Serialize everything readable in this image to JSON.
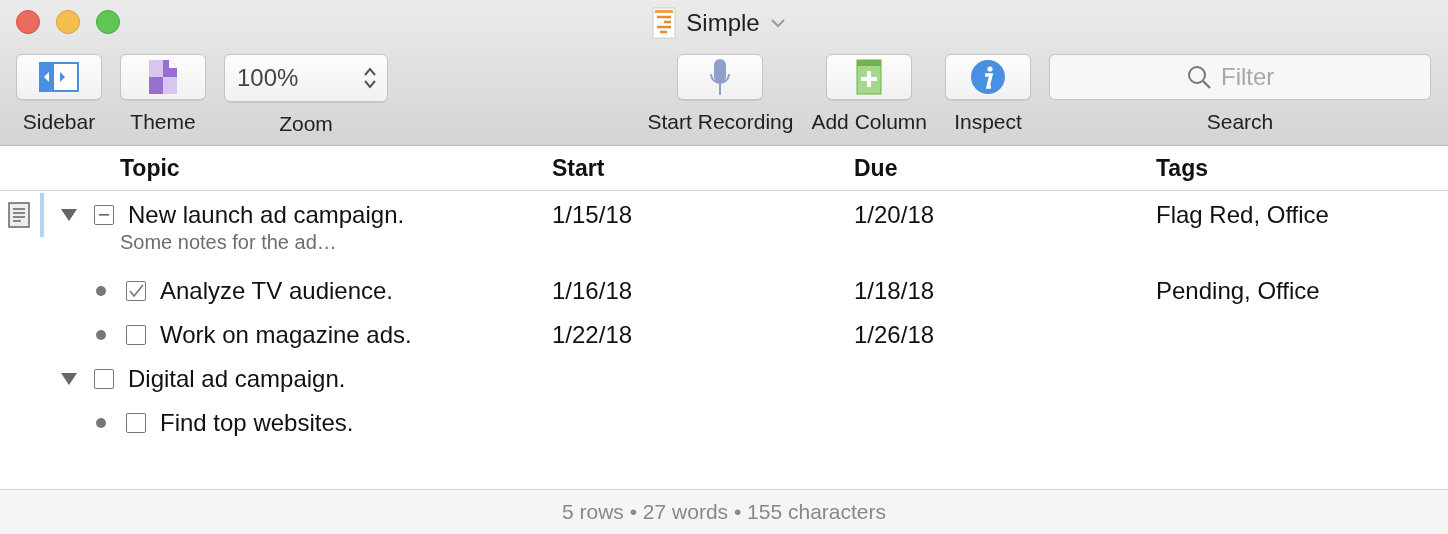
{
  "window": {
    "title": "Simple"
  },
  "toolbar": {
    "left": [
      {
        "kind": "button",
        "label": "Sidebar"
      },
      {
        "kind": "button",
        "label": "Theme"
      },
      {
        "kind": "stepper",
        "label": "Zoom",
        "value": "100%"
      }
    ],
    "right": [
      {
        "kind": "button",
        "label": "Start Recording"
      },
      {
        "kind": "button",
        "label": "Add Column"
      },
      {
        "kind": "button",
        "label": "Inspect"
      },
      {
        "kind": "search",
        "label": "Search",
        "placeholder": "Filter"
      }
    ]
  },
  "table": {
    "columns": [
      "Topic",
      "Start",
      "Due",
      "Tags"
    ],
    "rows": [
      {
        "topic": "New launch ad campaign.",
        "note": "Some notes for the ad…",
        "has_note": true,
        "selected": true,
        "expanded": true,
        "checked": false,
        "mixed": true,
        "start": "1/15/18",
        "due": "1/20/18",
        "tags": "Flag Red, Office",
        "children": [
          {
            "topic": "Analyze TV audience.",
            "selected": false,
            "checked": true,
            "start": "1/16/18",
            "due": "1/18/18",
            "tags": "Pending, Office"
          },
          {
            "topic": "Work on magazine ads.",
            "selected": false,
            "checked": false,
            "start": "1/22/18",
            "due": "1/26/18"
          }
        ]
      },
      {
        "topic": "Digital ad campaign.",
        "selected": false,
        "expanded": true,
        "checked": false,
        "mixed": false,
        "children": [
          {
            "topic": "Find top websites.",
            "selected": false,
            "checked": false
          }
        ]
      }
    ]
  },
  "status_bar": "5 rows • 27 words • 155 characters"
}
